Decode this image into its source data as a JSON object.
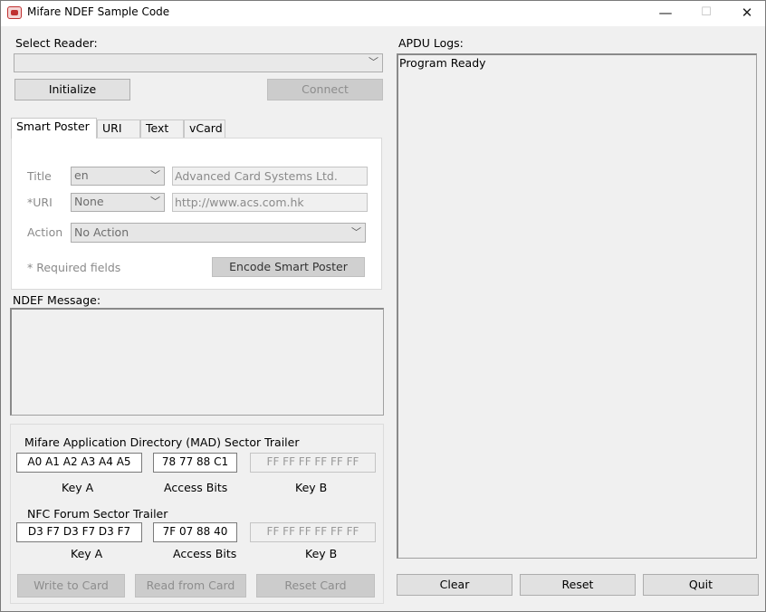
{
  "window": {
    "title": "Mifare NDEF Sample Code",
    "minimize": "—",
    "maximize": "☐",
    "close": "✕"
  },
  "reader": {
    "label": "Select Reader:",
    "selected": "",
    "initialize_label": "Initialize",
    "connect_label": "Connect"
  },
  "tabs": [
    "Smart Poster",
    "URI",
    "Text",
    "vCard"
  ],
  "smart_poster": {
    "title_label": "Title",
    "title_lang": "en",
    "title_value": "Advanced Card Systems Ltd.",
    "uri_label": "*URI",
    "uri_prefix": "None",
    "uri_value": "http://www.acs.com.hk",
    "action_label": "Action",
    "action_value": "No Action",
    "required_note": "* Required fields",
    "encode_label": "Encode Smart Poster"
  },
  "ndef": {
    "label": "NDEF Message:",
    "value": ""
  },
  "mad": {
    "heading": "Mifare Application Directory (MAD) Sector Trailer",
    "key_a": "A0 A1 A2 A3 A4 A5",
    "access_bits": "78 77 88 C1",
    "key_b": "FF FF FF FF FF FF",
    "key_a_label": "Key A",
    "access_bits_label": "Access Bits",
    "key_b_label": "Key B"
  },
  "nfc": {
    "heading": "NFC Forum Sector Trailer",
    "key_a": "D3 F7 D3 F7 D3 F7",
    "access_bits": "7F 07 88 40",
    "key_b": "FF FF FF FF FF FF",
    "key_a_label": "Key A",
    "access_bits_label": "Access Bits",
    "key_b_label": "Key B"
  },
  "card_actions": {
    "write_label": "Write to Card",
    "read_label": "Read from Card",
    "reset_label": "Reset Card"
  },
  "logs": {
    "label": "APDU Logs:",
    "text": "Program Ready"
  },
  "bottom": {
    "clear_label": "Clear",
    "reset_label": "Reset",
    "quit_label": "Quit"
  },
  "icons": {
    "app": "acs-app-icon",
    "dropdown": "chevron-down-icon"
  },
  "colors": {
    "window_bg": "#f0f0f0",
    "disabled_button": "#cccccc",
    "button": "#e1e1e1"
  }
}
